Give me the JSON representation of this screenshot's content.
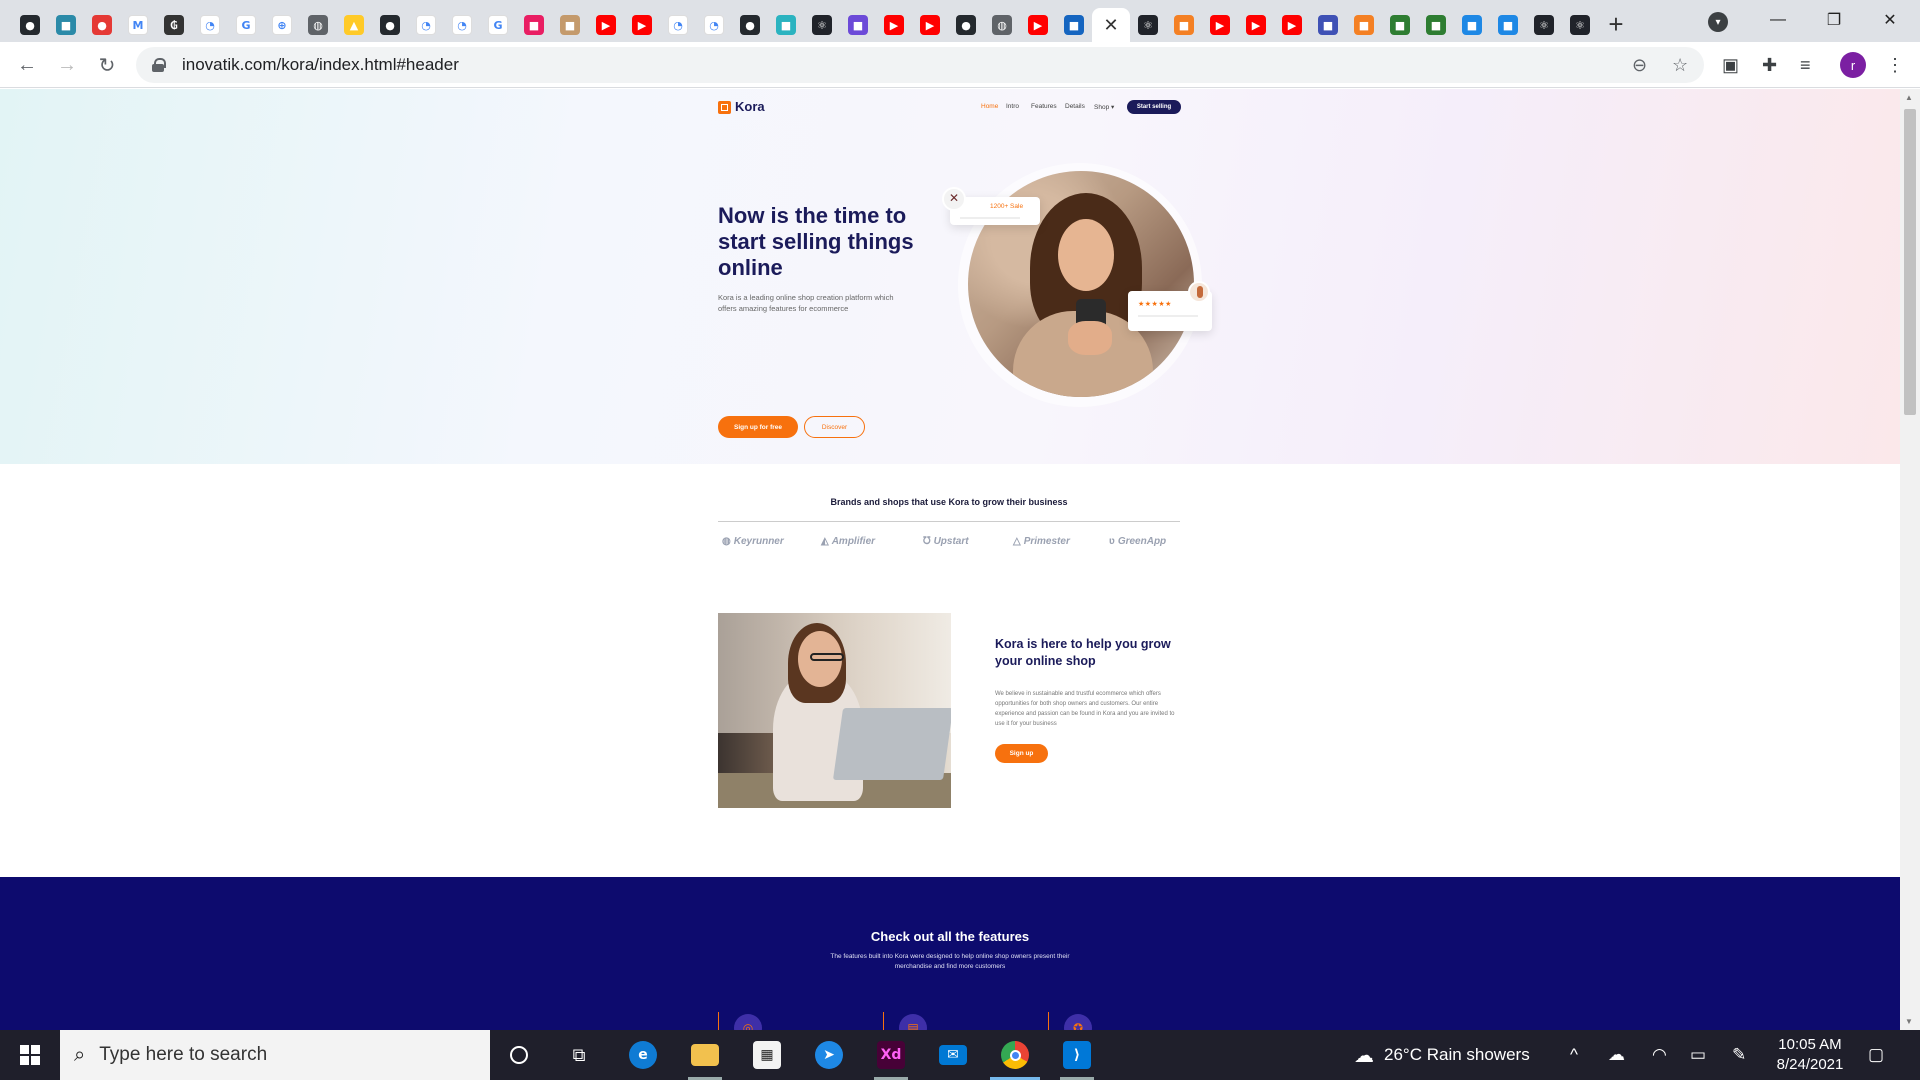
{
  "browser": {
    "tabs": [
      {
        "icon": "github-icon",
        "color": "#24292e"
      },
      {
        "icon": "app-icon",
        "color": "#2b8aa8"
      },
      {
        "icon": "record-icon",
        "color": "#e53935"
      },
      {
        "icon": "gmail-icon",
        "color": "#ffffff"
      },
      {
        "icon": "crypto-icon",
        "color": "#333333"
      },
      {
        "icon": "page-icon",
        "color": "#ffffff"
      },
      {
        "icon": "google-icon",
        "color": "#ffffff"
      },
      {
        "icon": "zoom-icon",
        "color": "#ffffff"
      },
      {
        "icon": "globe-icon",
        "color": "#5f6368"
      },
      {
        "icon": "firebase-icon",
        "color": "#ffca28"
      },
      {
        "icon": "github-icon",
        "color": "#24292e"
      },
      {
        "icon": "page-icon",
        "color": "#ffffff"
      },
      {
        "icon": "page-icon",
        "color": "#ffffff"
      },
      {
        "icon": "google-icon",
        "color": "#ffffff"
      },
      {
        "icon": "app-icon",
        "color": "#e91e63"
      },
      {
        "icon": "app-icon",
        "color": "#c49a6c"
      },
      {
        "icon": "youtube-icon",
        "color": "#ff0000"
      },
      {
        "icon": "youtube-icon",
        "color": "#ff0000"
      },
      {
        "icon": "page-icon",
        "color": "#ffffff"
      },
      {
        "icon": "page-icon",
        "color": "#ffffff"
      },
      {
        "icon": "github-icon",
        "color": "#24292e"
      },
      {
        "icon": "app-icon",
        "color": "#2bb3c0"
      },
      {
        "icon": "react-icon",
        "color": "#20232a"
      },
      {
        "icon": "app-icon",
        "color": "#6c4ad8"
      },
      {
        "icon": "youtube-icon",
        "color": "#ff0000"
      },
      {
        "icon": "youtube-icon",
        "color": "#ff0000"
      },
      {
        "icon": "github-icon",
        "color": "#24292e"
      },
      {
        "icon": "globe-icon",
        "color": "#5f6368"
      },
      {
        "icon": "youtube-icon",
        "color": "#ff0000"
      },
      {
        "icon": "app-icon",
        "color": "#1565c0"
      },
      {
        "icon": "close-icon",
        "color": "#ffffff",
        "active": true
      },
      {
        "icon": "react-icon",
        "color": "#20232a"
      },
      {
        "icon": "app-icon",
        "color": "#f48024"
      },
      {
        "icon": "youtube-icon",
        "color": "#ff0000"
      },
      {
        "icon": "youtube-icon",
        "color": "#ff0000"
      },
      {
        "icon": "youtube-icon",
        "color": "#ff0000"
      },
      {
        "icon": "app-icon",
        "color": "#3f51b5"
      },
      {
        "icon": "app-icon",
        "color": "#f48024"
      },
      {
        "icon": "app-icon",
        "color": "#2e7d32"
      },
      {
        "icon": "app-icon",
        "color": "#2e7d32"
      },
      {
        "icon": "app-icon",
        "color": "#1e88e5"
      },
      {
        "icon": "app-icon",
        "color": "#1e88e5"
      },
      {
        "icon": "react-icon",
        "color": "#20232a"
      },
      {
        "icon": "react-icon",
        "color": "#20232a"
      }
    ],
    "url": "inovatik.com/kora/index.html#header",
    "profile_initial": "r"
  },
  "site": {
    "logo": "Kora",
    "nav": [
      "Home",
      "Intro",
      "Features",
      "Details",
      "Shop ▾"
    ],
    "nav_cta": "Start selling",
    "hero_title": "Now is the time to start selling things online",
    "hero_sub": "Kora is a leading online shop creation platform which offers amazing features for ecommerce",
    "btn_signup_free": "Sign up for free",
    "btn_discover": "Discover",
    "sale_badge": "1200+ Sale",
    "rating_stars": "★★★★★",
    "brands_title": "Brands and shops that use Kora to grow their business",
    "brands": [
      "Keyrunner",
      "Amplifier",
      "Upstart",
      "Primester",
      "GreenApp"
    ],
    "about_title": "Kora is here to help you grow your online shop",
    "about_text": "We believe in sustainable and trustful ecommerce which offers opportunities for both shop owners and customers. Our entire experience and passion can be found in Kora and you are invited to use it for your business",
    "about_btn": "Sign up",
    "features_title": "Check out all the features",
    "features_sub": "The features built into Kora were designed to help online shop owners present their merchandise and find more customers"
  },
  "taskbar": {
    "search_placeholder": "Type here to search",
    "weather": "26°C  Rain showers",
    "time": "10:05 AM",
    "date": "8/24/2021"
  },
  "colors": {
    "accent": "#f7710e",
    "navy": "#1b1b5a",
    "features_bg": "#0d0b6e"
  }
}
